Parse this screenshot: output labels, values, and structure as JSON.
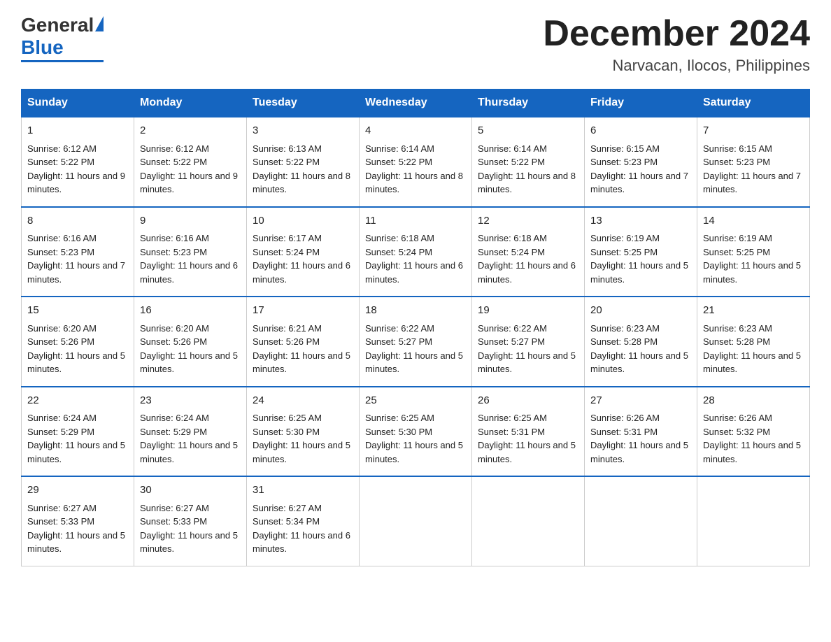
{
  "header": {
    "logo": {
      "general": "General",
      "blue": "Blue"
    },
    "title": "December 2024",
    "location": "Narvacan, Ilocos, Philippines"
  },
  "calendar": {
    "days": [
      "Sunday",
      "Monday",
      "Tuesday",
      "Wednesday",
      "Thursday",
      "Friday",
      "Saturday"
    ],
    "weeks": [
      [
        {
          "day": "1",
          "sunrise": "6:12 AM",
          "sunset": "5:22 PM",
          "daylight": "11 hours and 9 minutes."
        },
        {
          "day": "2",
          "sunrise": "6:12 AM",
          "sunset": "5:22 PM",
          "daylight": "11 hours and 9 minutes."
        },
        {
          "day": "3",
          "sunrise": "6:13 AM",
          "sunset": "5:22 PM",
          "daylight": "11 hours and 8 minutes."
        },
        {
          "day": "4",
          "sunrise": "6:14 AM",
          "sunset": "5:22 PM",
          "daylight": "11 hours and 8 minutes."
        },
        {
          "day": "5",
          "sunrise": "6:14 AM",
          "sunset": "5:22 PM",
          "daylight": "11 hours and 8 minutes."
        },
        {
          "day": "6",
          "sunrise": "6:15 AM",
          "sunset": "5:23 PM",
          "daylight": "11 hours and 7 minutes."
        },
        {
          "day": "7",
          "sunrise": "6:15 AM",
          "sunset": "5:23 PM",
          "daylight": "11 hours and 7 minutes."
        }
      ],
      [
        {
          "day": "8",
          "sunrise": "6:16 AM",
          "sunset": "5:23 PM",
          "daylight": "11 hours and 7 minutes."
        },
        {
          "day": "9",
          "sunrise": "6:16 AM",
          "sunset": "5:23 PM",
          "daylight": "11 hours and 6 minutes."
        },
        {
          "day": "10",
          "sunrise": "6:17 AM",
          "sunset": "5:24 PM",
          "daylight": "11 hours and 6 minutes."
        },
        {
          "day": "11",
          "sunrise": "6:18 AM",
          "sunset": "5:24 PM",
          "daylight": "11 hours and 6 minutes."
        },
        {
          "day": "12",
          "sunrise": "6:18 AM",
          "sunset": "5:24 PM",
          "daylight": "11 hours and 6 minutes."
        },
        {
          "day": "13",
          "sunrise": "6:19 AM",
          "sunset": "5:25 PM",
          "daylight": "11 hours and 5 minutes."
        },
        {
          "day": "14",
          "sunrise": "6:19 AM",
          "sunset": "5:25 PM",
          "daylight": "11 hours and 5 minutes."
        }
      ],
      [
        {
          "day": "15",
          "sunrise": "6:20 AM",
          "sunset": "5:26 PM",
          "daylight": "11 hours and 5 minutes."
        },
        {
          "day": "16",
          "sunrise": "6:20 AM",
          "sunset": "5:26 PM",
          "daylight": "11 hours and 5 minutes."
        },
        {
          "day": "17",
          "sunrise": "6:21 AM",
          "sunset": "5:26 PM",
          "daylight": "11 hours and 5 minutes."
        },
        {
          "day": "18",
          "sunrise": "6:22 AM",
          "sunset": "5:27 PM",
          "daylight": "11 hours and 5 minutes."
        },
        {
          "day": "19",
          "sunrise": "6:22 AM",
          "sunset": "5:27 PM",
          "daylight": "11 hours and 5 minutes."
        },
        {
          "day": "20",
          "sunrise": "6:23 AM",
          "sunset": "5:28 PM",
          "daylight": "11 hours and 5 minutes."
        },
        {
          "day": "21",
          "sunrise": "6:23 AM",
          "sunset": "5:28 PM",
          "daylight": "11 hours and 5 minutes."
        }
      ],
      [
        {
          "day": "22",
          "sunrise": "6:24 AM",
          "sunset": "5:29 PM",
          "daylight": "11 hours and 5 minutes."
        },
        {
          "day": "23",
          "sunrise": "6:24 AM",
          "sunset": "5:29 PM",
          "daylight": "11 hours and 5 minutes."
        },
        {
          "day": "24",
          "sunrise": "6:25 AM",
          "sunset": "5:30 PM",
          "daylight": "11 hours and 5 minutes."
        },
        {
          "day": "25",
          "sunrise": "6:25 AM",
          "sunset": "5:30 PM",
          "daylight": "11 hours and 5 minutes."
        },
        {
          "day": "26",
          "sunrise": "6:25 AM",
          "sunset": "5:31 PM",
          "daylight": "11 hours and 5 minutes."
        },
        {
          "day": "27",
          "sunrise": "6:26 AM",
          "sunset": "5:31 PM",
          "daylight": "11 hours and 5 minutes."
        },
        {
          "day": "28",
          "sunrise": "6:26 AM",
          "sunset": "5:32 PM",
          "daylight": "11 hours and 5 minutes."
        }
      ],
      [
        {
          "day": "29",
          "sunrise": "6:27 AM",
          "sunset": "5:33 PM",
          "daylight": "11 hours and 5 minutes."
        },
        {
          "day": "30",
          "sunrise": "6:27 AM",
          "sunset": "5:33 PM",
          "daylight": "11 hours and 5 minutes."
        },
        {
          "day": "31",
          "sunrise": "6:27 AM",
          "sunset": "5:34 PM",
          "daylight": "11 hours and 6 minutes."
        },
        null,
        null,
        null,
        null
      ]
    ]
  }
}
